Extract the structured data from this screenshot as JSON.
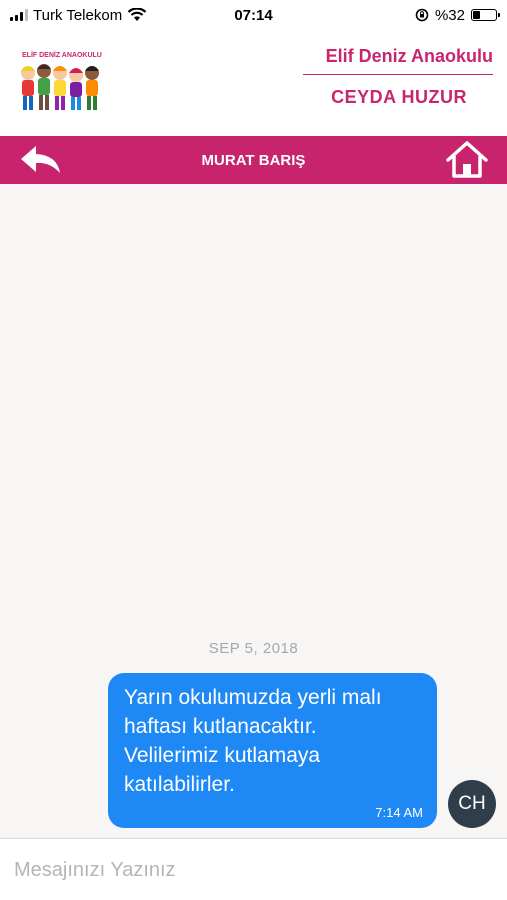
{
  "status_bar": {
    "carrier": "Turk Telekom",
    "time": "07:14",
    "battery": "%32",
    "battery_level": 0.32
  },
  "header": {
    "logo_text": "ELİF DENİZ ANAOKULU",
    "school_name": "Elif Deniz Anaokulu",
    "teacher_name": "CEYDA HUZUR"
  },
  "navbar": {
    "title": "MURAT BARIŞ",
    "back_icon": "back-arrow-icon",
    "home_icon": "home-icon"
  },
  "chat": {
    "date": "SEP 5, 2018",
    "messages": [
      {
        "text": "Yarın okulumuzda yerli malı haftası kutlanacaktır. Velilerimiz kutlamaya katılabilirler.",
        "time": "7:14 AM",
        "avatar_initials": "CH"
      }
    ]
  },
  "input": {
    "placeholder": "Mesajınızı Yazınız",
    "value": ""
  },
  "colors": {
    "brand": "#c8246e",
    "bubble": "#1e88f5",
    "avatar": "#2f3e4a"
  }
}
